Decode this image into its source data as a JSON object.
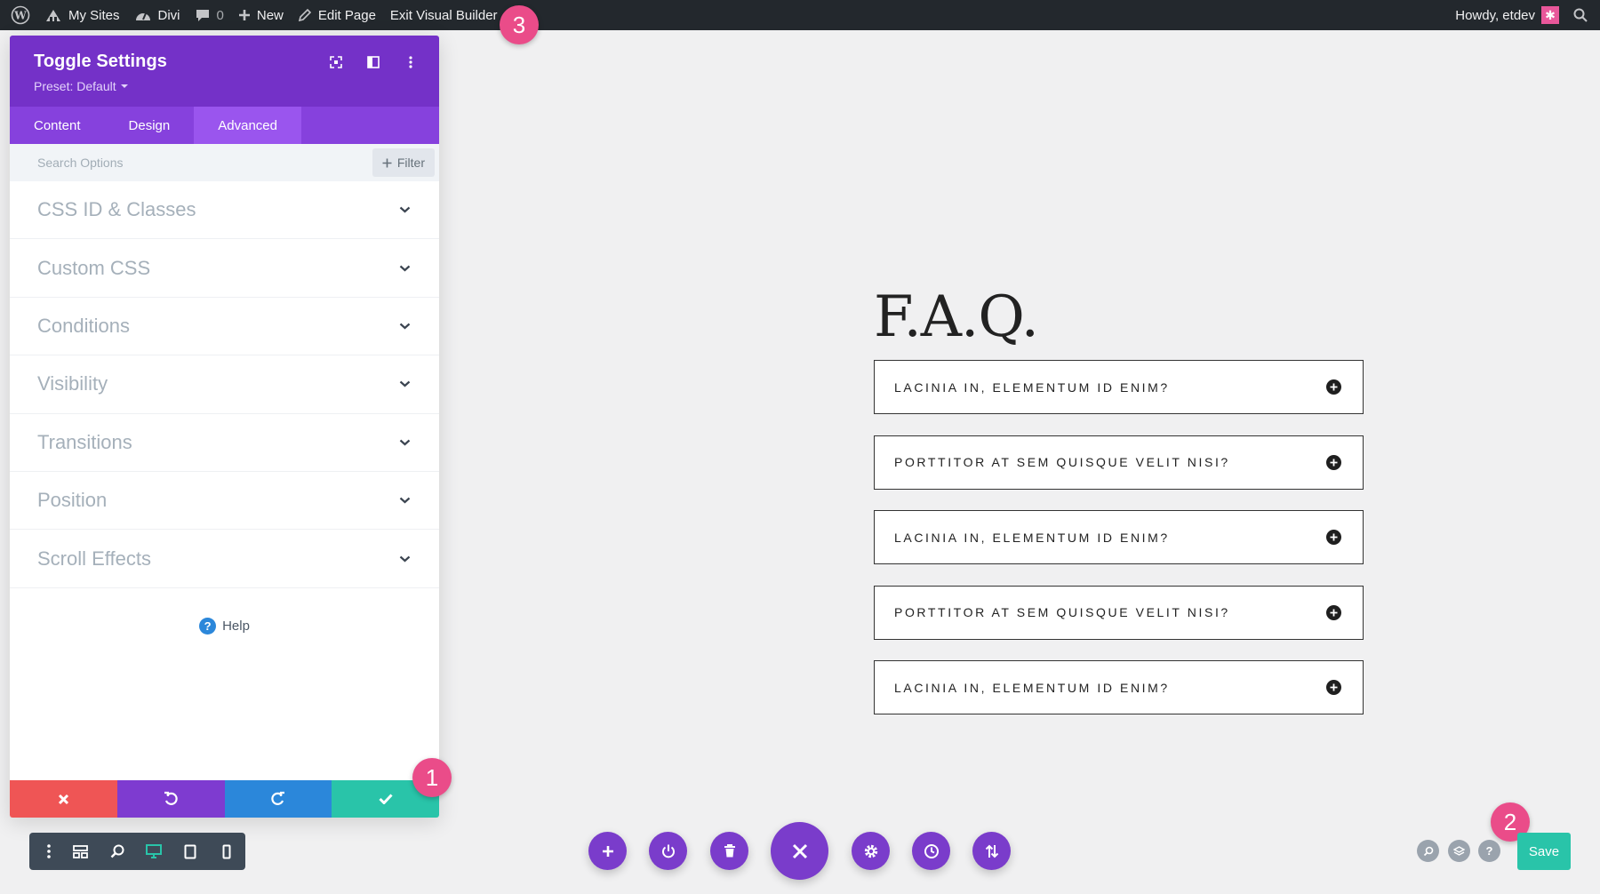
{
  "adminbar": {
    "my_sites": "My Sites",
    "divi": "Divi",
    "comments_count": "0",
    "new": "New",
    "edit_page": "Edit Page",
    "exit_builder": "Exit Visual Builder",
    "howdy": "Howdy, etdev"
  },
  "panel": {
    "title": "Toggle Settings",
    "preset": "Preset: Default",
    "tabs": [
      "Content",
      "Design",
      "Advanced"
    ],
    "active_tab": "Advanced",
    "search_placeholder": "Search Options",
    "filter_label": "Filter",
    "groups": [
      "CSS ID & Classes",
      "Custom CSS",
      "Conditions",
      "Visibility",
      "Transitions",
      "Position",
      "Scroll Effects"
    ],
    "help_label": "Help"
  },
  "badges": [
    "1",
    "2",
    "3"
  ],
  "faq": {
    "title": "F.A.Q.",
    "questions": [
      "LACINIA IN, ELEMENTUM ID ENIM?",
      "PORTTITOR AT SEM QUISQUE VELIT NISI?",
      "LACINIA IN, ELEMENTUM ID ENIM?",
      "PORTTITOR AT SEM QUISQUE VELIT NISI?",
      "LACINIA IN, ELEMENTUM ID ENIM?"
    ]
  },
  "save_label": "Save",
  "colors": {
    "purple": "#7431c8",
    "teal": "#29c4a9",
    "red": "#ef5555",
    "blue": "#2b87da",
    "badge": "#ea4c89"
  }
}
